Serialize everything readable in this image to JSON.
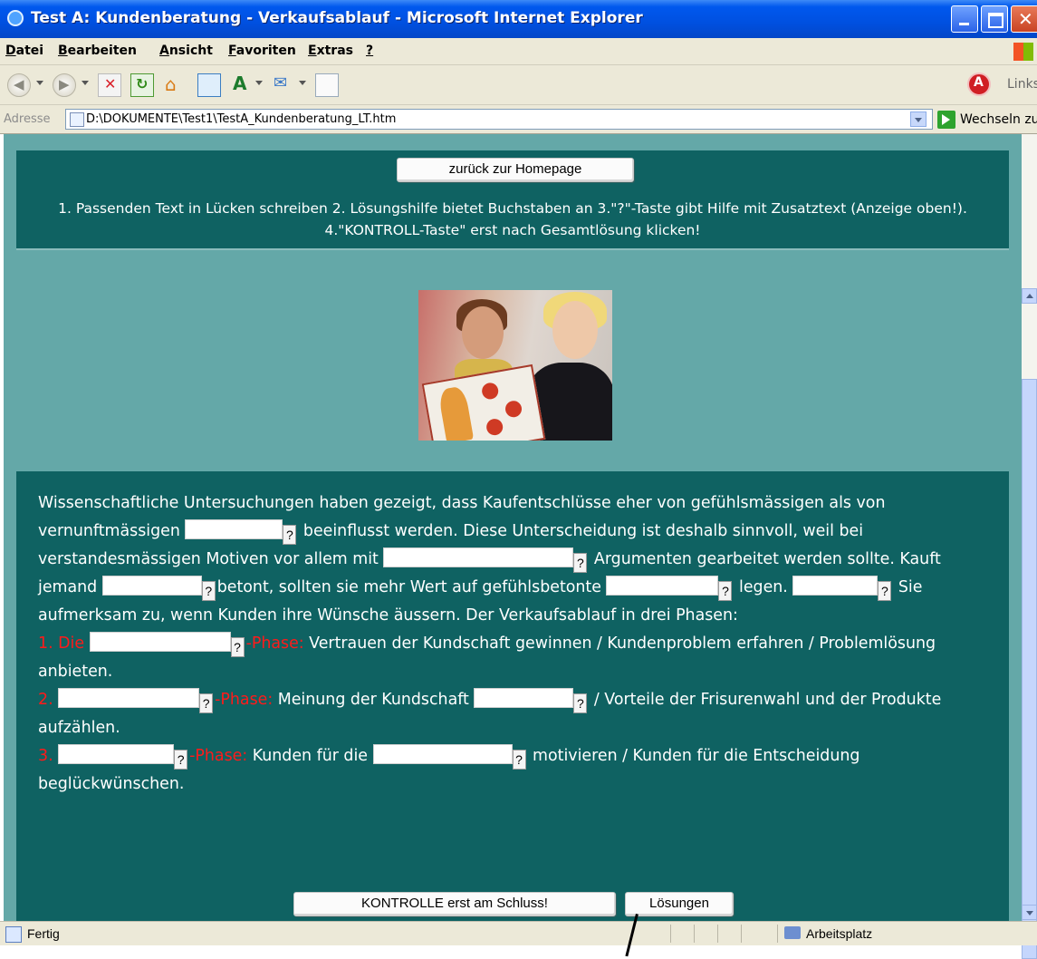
{
  "window": {
    "title": "Test A: Kundenberatung - Verkaufsablauf - Microsoft Internet Explorer"
  },
  "menu": {
    "items": [
      {
        "u": "D",
        "rest": "atei"
      },
      {
        "u": "B",
        "rest": "earbeiten"
      },
      {
        "u": "A",
        "rest": "nsicht"
      },
      {
        "u": "F",
        "rest": "avoriten"
      },
      {
        "u": "E",
        "rest": "xtras",
        "pre": ""
      },
      {
        "u": "?",
        "rest": ""
      }
    ]
  },
  "toolbar": {
    "icons": [
      "back-icon",
      "forward-icon",
      "stop-icon",
      "refresh-icon",
      "home-icon",
      "media-icon",
      "font-size-icon",
      "mail-icon",
      "print-preview-icon",
      "pdf-icon"
    ],
    "links_label": "Links"
  },
  "address": {
    "label": "Adresse",
    "url": "D:\\DOKUMENTE\\Test1\\TestA_Kundenberatung_LT.htm",
    "go_label": "Wechseln zu"
  },
  "page": {
    "home_button": "zurück zur Homepage",
    "instructions": "1. Passenden Text in Lücken schreiben 2. Lösungshilfe bietet Buchstaben an 3.\"?\"-Taste gibt Hilfe mit Zusatztext (Anzeige oben!). 4.\"KONTROLL-Taste\" erst nach Gesamtlösung klicken!",
    "hint_label": "?",
    "passage": {
      "t1": "Wissenschaftliche Untersuchungen haben gezeigt, dass Kaufentschlüsse eher von gefühlsmässigen als von vernunftmässigen ",
      "t2": " beeinflusst werden. Diese Unterscheidung ist deshalb sinnvoll, weil bei verstandesmässigen Motiven vor allem mit ",
      "t3": " Argumenten gearbeitet werden sollte. Kauft jemand ",
      "t4": "betont, sollten sie mehr Wert auf gefühlsbetonte ",
      "t5": " legen. ",
      "t6": " Sie aufmerksam zu, wenn Kunden ihre Wünsche äussern. Der Verkaufsablauf in drei Phasen:",
      "p1_num": "1. Die ",
      "p1_phase": "-Phase:",
      "p1_text": " Vertrauen der Kundschaft gewinnen / Kundenproblem erfahren / Problemlösung anbieten.",
      "p2_num": "2. ",
      "p2_phase": "-Phase:",
      "p2_text1": " Meinung der Kundschaft ",
      "p2_text2": " / Vorteile der Frisurenwahl und der Produkte aufzählen.",
      "p3_num": "3. ",
      "p3_phase": "-Phase:",
      "p3_text1": " Kunden für die ",
      "p3_text2": " motivieren / Kunden für die Entscheidung beglückwünschen."
    },
    "check_button": "KONTROLLE erst am Schluss!",
    "solutions_button": "Lösungen"
  },
  "status": {
    "text": "Fertig",
    "zone": "Arbeitsplatz"
  },
  "colors": {
    "page_bg": "#64a8a8",
    "panel_bg": "#0f6262",
    "phase_red": "#ff1a1a"
  }
}
